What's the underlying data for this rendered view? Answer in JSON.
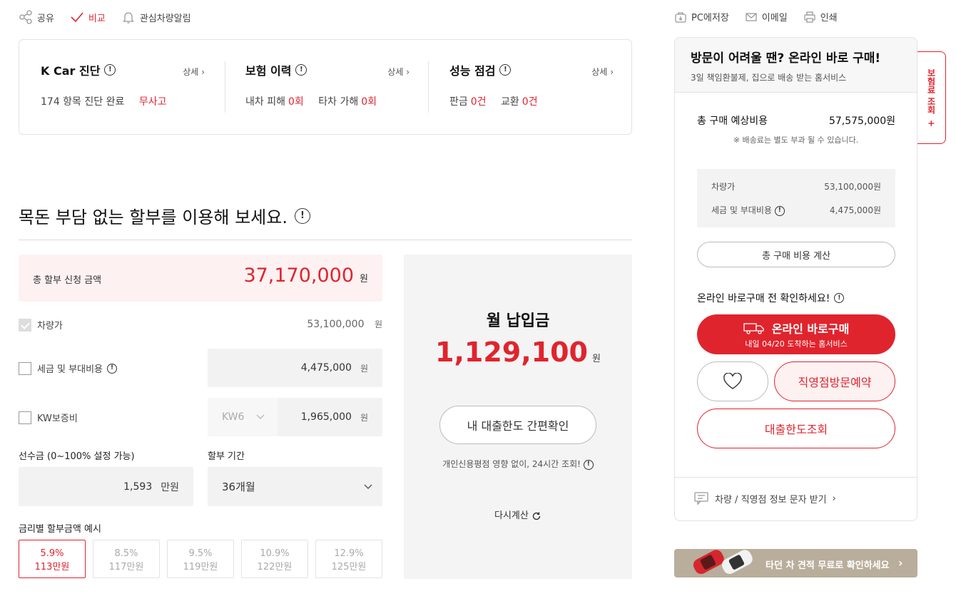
{
  "top_actions": {
    "share": "공유",
    "compare": "비교",
    "alert": "관심차량알림"
  },
  "top_right": {
    "save": "PC에저장",
    "email": "이메일",
    "print": "인쇄"
  },
  "report": {
    "kcar": {
      "title": "K Car 진단",
      "more": "상세",
      "text": "174 항목 진단 완료",
      "status": "무사고"
    },
    "insurance": {
      "title": "보험 이력",
      "more": "상세",
      "own_label": "내차 피해",
      "own_value": "0회",
      "other_label": "타차 가해",
      "other_value": "0회"
    },
    "inspection": {
      "title": "성능 점검",
      "more": "상세",
      "panel_label": "판금",
      "panel_value": "0건",
      "replace_label": "교환",
      "replace_value": "0건"
    }
  },
  "installment": {
    "heading": "목돈 부담 없는 할부를 이용해 보세요.",
    "total_label": "총 할부 신청 금액",
    "total_value": "37,170,000",
    "unit": "원",
    "car_label": "차량가",
    "car_value": "53,100,000",
    "tax_label": "세금 및 부대비용",
    "tax_value": "4,475,000",
    "kw_label": "KW보증비",
    "kw_option": "KW6",
    "kw_value": "1,965,000",
    "down_label": "선수금 (0~100% 설정 가능)",
    "down_value": "1,593",
    "down_unit": "만원",
    "term_label": "할부 기간",
    "term_value": "36개월",
    "rates_label": "금리별 할부금액 예시",
    "rates": [
      {
        "rate": "5.9%",
        "amount": "113만원"
      },
      {
        "rate": "8.5%",
        "amount": "117만원"
      },
      {
        "rate": "9.5%",
        "amount": "119만원"
      },
      {
        "rate": "10.9%",
        "amount": "122만원"
      },
      {
        "rate": "12.9%",
        "amount": "125만원"
      }
    ]
  },
  "monthly": {
    "title": "월 납입금",
    "value": "1,129,100",
    "unit": "원",
    "check_button": "내 대출한도 간편확인",
    "note": "개인신용평점 영향 없이, 24시간 조회!",
    "recalc": "다시계산"
  },
  "purchase": {
    "header_title": "방문이 어려울 땐? 온라인 바로 구매!",
    "header_sub": "3일 책임환불제, 집으로 배송 받는 홈서비스",
    "total_label": "총 구매 예상비용",
    "total_value": "57,575,000원",
    "delivery_note": "※ 배송료는 별도 부과 될 수 있습니다.",
    "car_label": "차량가",
    "car_value": "53,100,000원",
    "tax_label": "세금 및 부대비용",
    "tax_value": "4,475,000원",
    "calc_button": "총 구매 비용 계산",
    "check_title": "온라인 바로구매 전 확인하세요!",
    "buy_button": "온라인 바로구매",
    "buy_sub": "내일 04/20 도착하는 홈서비스",
    "visit_button": "직영점방문예약",
    "loan_button": "대출한도조회",
    "sms_link": "차량 / 직영점 정보 문자 받기"
  },
  "side_tab": "보험료 조회",
  "side_tab_plus": "+",
  "banner": "타던 차 견적 무료로 확인하세요",
  "colors": {
    "accent": "#e0242e",
    "panel": "#f4f4f4"
  }
}
